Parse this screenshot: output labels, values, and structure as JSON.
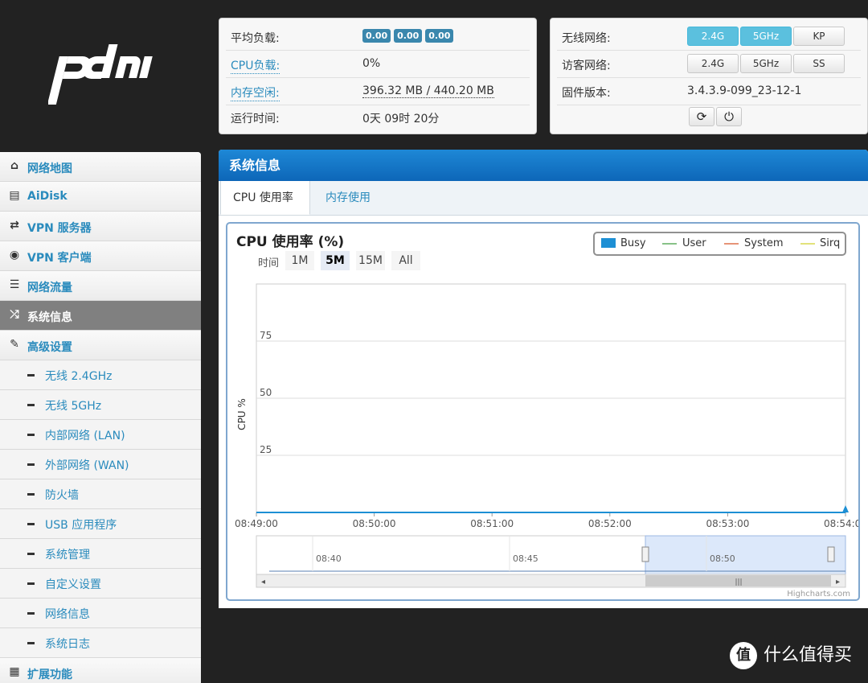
{
  "status": {
    "load_label": "平均负载:",
    "load_values": [
      "0.00",
      "0.00",
      "0.00"
    ],
    "cpu_label": "CPU负载:",
    "cpu_value": "0%",
    "mem_label": "内存空闲:",
    "mem_value": "396.32 MB / 440.20 MB",
    "uptime_label": "运行时间:",
    "uptime_value": "0天 09时 20分"
  },
  "wifi": {
    "wireless_label": "无线网络:",
    "wireless_buttons": [
      "2.4G",
      "5GHz",
      "KP"
    ],
    "guest_label": "访客网络:",
    "guest_buttons": [
      "2.4G",
      "5GHz",
      "SS"
    ],
    "firmware_label": "固件版本:",
    "firmware_value": "3.4.3.9-099_23-12-1"
  },
  "sidebar": {
    "items": [
      {
        "label": "网络地图",
        "icon": "home-icon"
      },
      {
        "label": "AiDisk",
        "icon": "disk-icon"
      },
      {
        "label": "VPN 服务器",
        "icon": "retweet-icon"
      },
      {
        "label": "VPN 客户端",
        "icon": "globe-icon"
      },
      {
        "label": "网络流量",
        "icon": "tasks-icon"
      },
      {
        "label": "系统信息",
        "icon": "random-icon"
      },
      {
        "label": "高级设置",
        "icon": "wrench-icon"
      }
    ],
    "subitems": [
      "无线 2.4GHz",
      "无线 5GHz",
      "内部网络 (LAN)",
      "外部网络 (WAN)",
      "防火墙",
      "USB 应用程序",
      "系统管理",
      "自定义设置",
      "网络信息",
      "系统日志"
    ],
    "last_item": "扩展功能"
  },
  "main": {
    "title": "系统信息",
    "tabs": [
      "CPU 使用率",
      "内存使用"
    ],
    "chart_title": "CPU 使用率 (%)",
    "range_label": "时间",
    "range_buttons": [
      "1M",
      "5M",
      "15M",
      "All"
    ],
    "credit": "Highcharts.com"
  },
  "chart_data": {
    "type": "line",
    "title": "CPU 使用率 (%)",
    "ylabel": "CPU %",
    "xlabel": "",
    "ylim": [
      0,
      100
    ],
    "y_ticks": [
      "75",
      "50",
      "25"
    ],
    "x_ticks": [
      "08:49:00",
      "08:50:00",
      "08:51:00",
      "08:52:00",
      "08:53:00",
      "08:54:00"
    ],
    "navigator_ticks": [
      "08:40",
      "08:45",
      "08:50"
    ],
    "series": [
      {
        "name": "Busy",
        "color": "#1d8fd4",
        "values": [
          0,
          0,
          0,
          0,
          0,
          0
        ]
      },
      {
        "name": "User",
        "color": "#88c288",
        "values": [
          0,
          0,
          0,
          0,
          0,
          0
        ]
      },
      {
        "name": "System",
        "color": "#e69478",
        "values": [
          0,
          0,
          0,
          0,
          0,
          0
        ]
      },
      {
        "name": "Sirq",
        "color": "#e2e27a",
        "values": [
          0,
          0,
          0,
          0,
          0,
          0
        ]
      }
    ],
    "grid": true,
    "legend_position": "top-right"
  },
  "watermark": {
    "icon_text": "值",
    "text": "什么值得买"
  }
}
